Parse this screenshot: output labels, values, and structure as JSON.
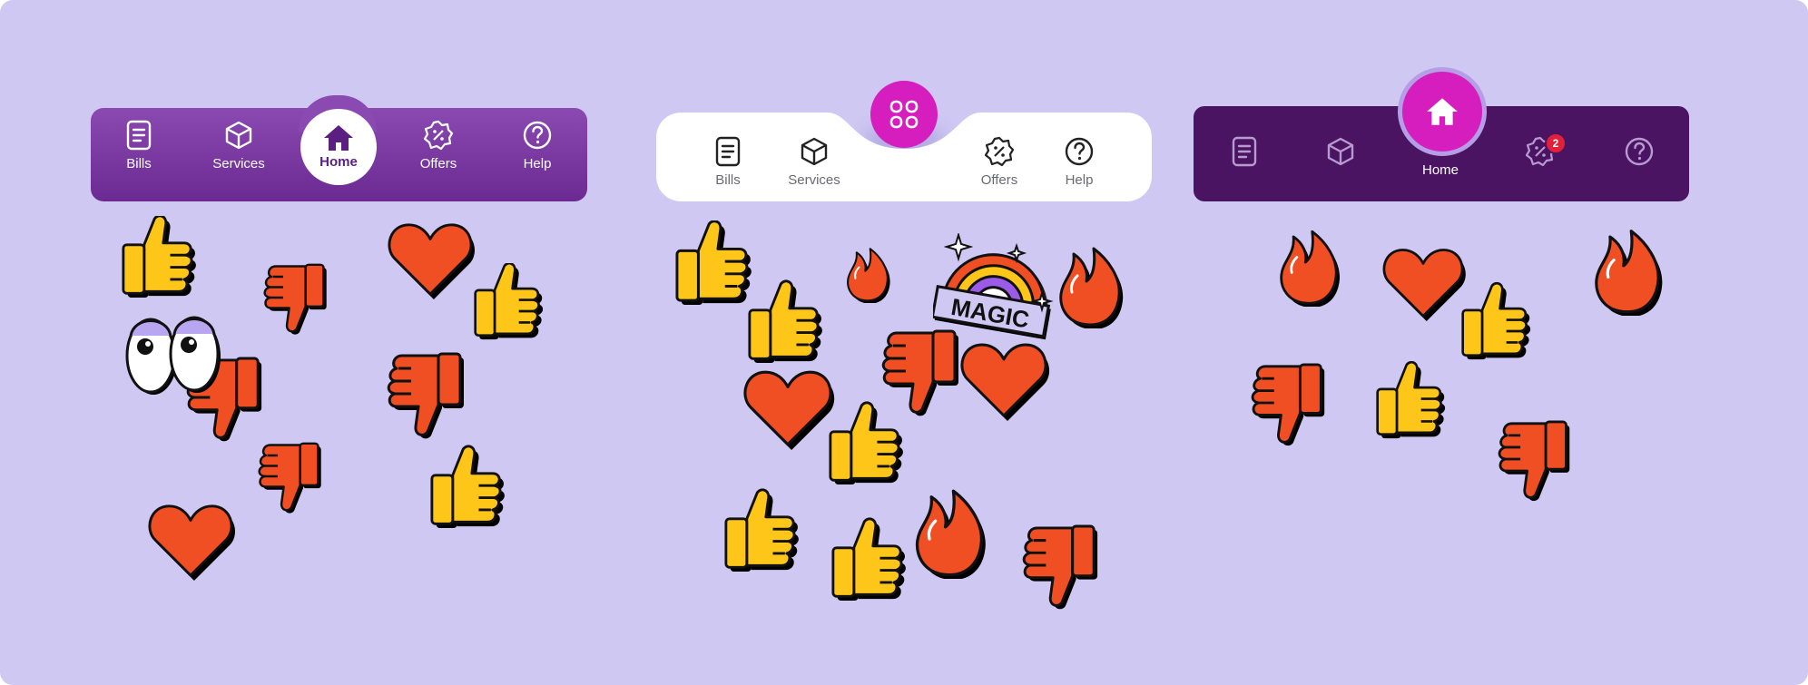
{
  "nav_variant_1": {
    "items": [
      {
        "label": "Bills",
        "icon": "bill-icon"
      },
      {
        "label": "Services",
        "icon": "box-icon"
      },
      {
        "label": "Home",
        "icon": "home-icon",
        "active": true
      },
      {
        "label": "Offers",
        "icon": "offer-tag-icon"
      },
      {
        "label": "Help",
        "icon": "help-icon"
      }
    ],
    "colors": {
      "bar": "#7a3aa2",
      "active_circle": "#ffffff",
      "active_text": "#5b1f82"
    }
  },
  "nav_variant_2": {
    "items": [
      {
        "label": "Bills",
        "icon": "bill-icon"
      },
      {
        "label": "Services",
        "icon": "box-icon"
      },
      {
        "label": "Offers",
        "icon": "offer-tag-icon"
      },
      {
        "label": "Help",
        "icon": "help-icon"
      }
    ],
    "fab_icon": "apps-grid-icon",
    "colors": {
      "bar": "#ffffff",
      "fab": "#d61dbe",
      "text": "#6a6a72"
    }
  },
  "nav_variant_3": {
    "items": [
      {
        "icon": "bill-icon"
      },
      {
        "icon": "box-icon"
      },
      {
        "label": "Home",
        "icon": "home-icon",
        "active": true
      },
      {
        "icon": "offer-tag-icon",
        "badge": "2"
      },
      {
        "icon": "help-icon"
      }
    ],
    "colors": {
      "bar": "#4a1462",
      "fab": "#d61dbe",
      "badge": "#e3203a"
    }
  },
  "stickers": {
    "magic_text": "MAGIC",
    "types": [
      "thumbs-up",
      "thumbs-down",
      "heart",
      "fire",
      "eyes",
      "rainbow"
    ],
    "colors": {
      "background": "#cfc8f3",
      "yellow": "#ffc61a",
      "orange": "#f04e23",
      "outline": "#111111"
    }
  }
}
